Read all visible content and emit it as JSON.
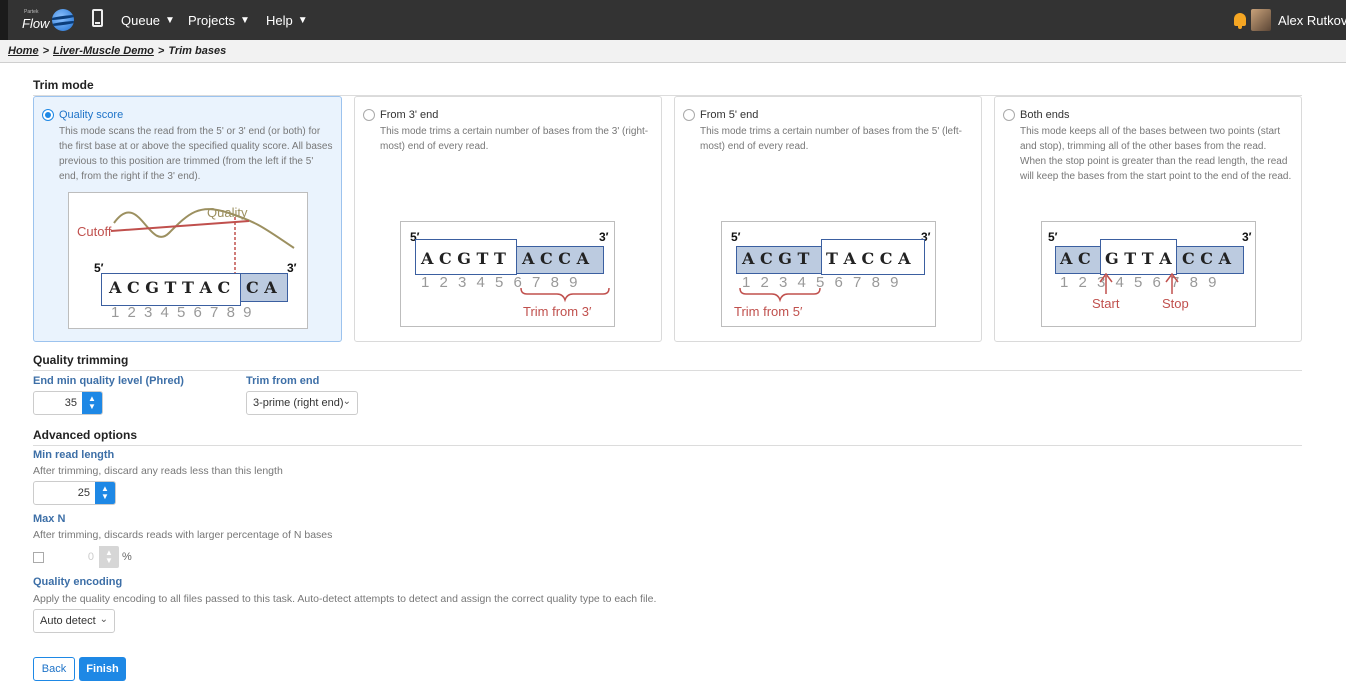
{
  "topbar": {
    "brand_small": "Partek",
    "brand_word": "Flow",
    "nav": [
      {
        "label": "Queue"
      },
      {
        "label": "Projects"
      },
      {
        "label": "Help"
      }
    ],
    "user_name": "Alex Rutkovsky"
  },
  "breadcrumb": {
    "home": "Home",
    "project": "Liver-Muscle Demo",
    "current": "Trim bases",
    "sep": ">"
  },
  "trim_mode": {
    "heading": "Trim mode",
    "cards": [
      {
        "title": "Quality score",
        "selected": true,
        "desc": "This mode scans the read from the 5' or 3' end (or both) for the first base at or above the specified quality score. All bases previous to this position are trimmed (from the left if the 5' end, from the right if the 3' end).",
        "diagram": {
          "quality_label": "Quality",
          "cutoff_label": "Cutoff",
          "five": "5′",
          "three": "3′",
          "letters_kept": "A C G T T A C",
          "letters_trimmed": "C A",
          "numbers": "1 2 3 4 5 6 7 8 9"
        }
      },
      {
        "title": "From 3' end",
        "selected": false,
        "desc": "This mode trims a certain number of bases from the 3' (right-most) end of every read.",
        "diagram": {
          "five": "5′",
          "three": "3′",
          "letters_kept": "A C G T T",
          "letters_trimmed": "A C C A",
          "numbers": "1 2 3 4 5 6 7 8 9",
          "trim_label": "Trim from 3′"
        }
      },
      {
        "title": "From 5' end",
        "selected": false,
        "desc": "This mode trims a certain number of bases from the 5' (left-most) end of every read.",
        "diagram": {
          "five": "5′",
          "three": "3′",
          "letters_trimmed": "A C G T",
          "letters_kept": "T A C C A",
          "numbers": "1 2 3 4 5 6 7 8 9",
          "trim_label": "Trim from 5′"
        }
      },
      {
        "title": "Both ends",
        "selected": false,
        "desc": "This mode keeps all of the bases between two points (start and stop), trimming all of the other bases from the read. When the stop point is greater than the read length, the read will keep the bases from the start point to the end of the read.",
        "diagram": {
          "five": "5′",
          "three": "3′",
          "letters_left": "A C",
          "letters_kept": "G T T A",
          "letters_right": "C C A",
          "numbers": "1 2 3 4 5 6 7 8 9",
          "start_label": "Start",
          "stop_label": "Stop"
        }
      }
    ]
  },
  "quality_trimming": {
    "heading": "Quality trimming",
    "min_quality_label": "End min quality level (Phred)",
    "min_quality_value": "35",
    "trim_from_end_label": "Trim from end",
    "trim_from_end_value": "3-prime (right end)"
  },
  "advanced": {
    "heading": "Advanced options",
    "min_read_length_label": "Min read length",
    "min_read_length_help": "After trimming, discard any reads less than this length",
    "min_read_length_value": "25",
    "max_n_label": "Max N",
    "max_n_help": "After trimming, discards reads with larger percentage of N bases",
    "max_n_value": "0",
    "max_n_unit": "%",
    "quality_encoding_label": "Quality encoding",
    "quality_encoding_help": "Apply the quality encoding to all files passed to this task. Auto-detect attempts to detect and assign the correct quality type to each file.",
    "quality_encoding_value": "Auto detect"
  },
  "buttons": {
    "back": "Back",
    "finish": "Finish"
  },
  "icons": {
    "chevron": "chevron-down-icon",
    "spinner_up": "chevron-up-icon",
    "spinner_down": "chevron-down-icon"
  },
  "colors": {
    "accent": "#1e88e5",
    "topbar": "#333333",
    "trimmed_shade": "#bccbe0",
    "trim_red": "#c0504d",
    "quality_curve": "#9c9060"
  }
}
